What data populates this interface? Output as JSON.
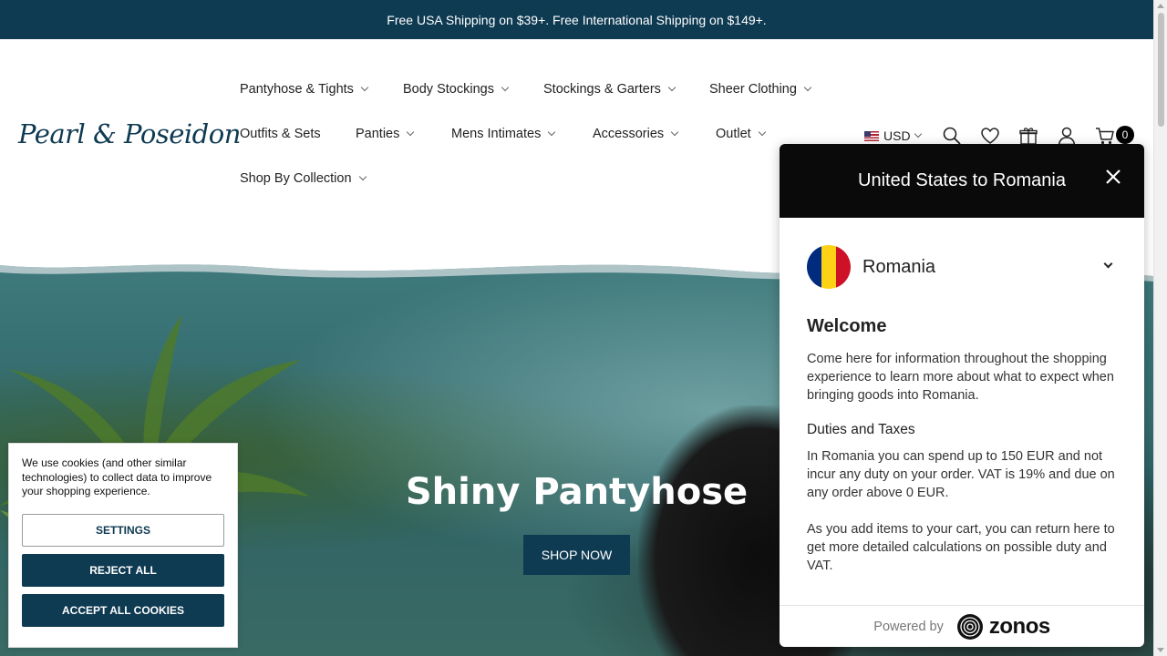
{
  "announcement": "Free USA Shipping on $39+. Free International Shipping on $149+.",
  "brand": {
    "logo": "Pearl & Poseidon"
  },
  "nav": {
    "items": [
      {
        "label": "Pantyhose & Tights"
      },
      {
        "label": "Body Stockings"
      },
      {
        "label": "Stockings & Garters"
      },
      {
        "label": "Sheer Clothing"
      },
      {
        "label": "Outfits & Sets"
      },
      {
        "label": "Panties"
      },
      {
        "label": "Mens Intimates"
      },
      {
        "label": "Accessories"
      },
      {
        "label": "Outlet"
      },
      {
        "label": "Shop By Collection"
      }
    ]
  },
  "utility": {
    "currency": "USD",
    "cart_count": "0"
  },
  "hero": {
    "title": "Shiny Pantyhose",
    "button": "SHOP NOW"
  },
  "cookie": {
    "text": "We use cookies (and other similar technologies) to collect data to improve your shopping experience.",
    "settings": "SETTINGS",
    "reject": "REJECT ALL",
    "accept": "ACCEPT ALL COOKIES"
  },
  "modal": {
    "title": "United States to Romania",
    "country": "Romania",
    "welcome_heading": "Welcome",
    "welcome_text": "Come here for information throughout the shopping experience to learn more about what to expect when bringing goods into Romania.",
    "duties_heading": "Duties and Taxes",
    "duties_text": "In Romania you can spend up to 150 EUR and not incur any duty on your order. VAT is 19% and due on any order above 0 EUR.",
    "cart_text": "As you add items to your cart, you can return here to get more detailed calculations on possible duty and VAT.",
    "powered_by": "Powered by",
    "provider": "zonos"
  },
  "colors": {
    "brand": "#0e3a52",
    "modal_header": "#0a0a0a"
  },
  "icons": [
    "search-icon",
    "heart-icon",
    "gift-icon",
    "user-icon",
    "cart-icon",
    "close-icon",
    "chevron-down-icon"
  ]
}
